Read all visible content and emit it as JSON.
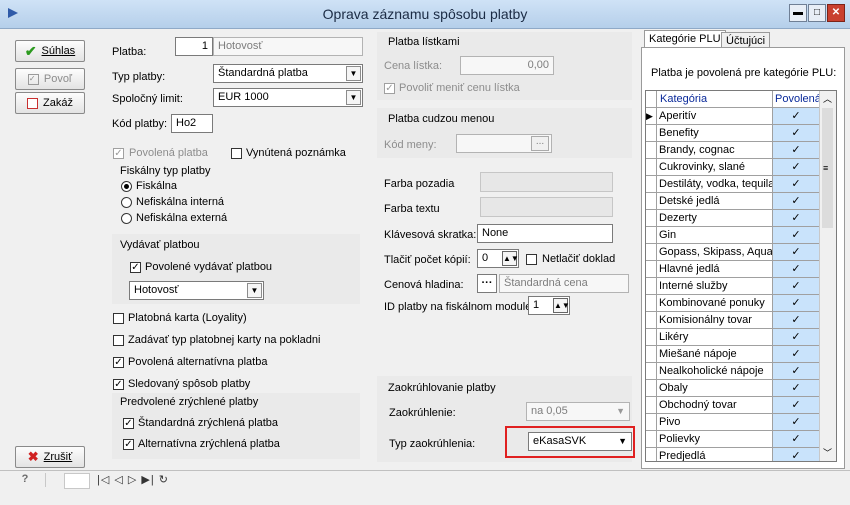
{
  "window": {
    "title": "Oprava záznamu spôsobu platby"
  },
  "buttons": {
    "ok": "Súhlas",
    "allow": "Povoľ",
    "forbid": "Zakáž",
    "cancel": "Zrušiť"
  },
  "form": {
    "platba_label": "Platba:",
    "platba_num": "1",
    "platba_name": "Hotovosť",
    "typ_label": "Typ platby:",
    "typ_value": "Štandardná platba",
    "limit_label": "Spoločný limit:",
    "limit_value": "EUR 1000",
    "kod_label": "Kód platby:",
    "kod_value": "Ho2",
    "povolena_label": "Povolená platba",
    "vynutena_label": "Vynútená poznámka",
    "fiscal_group": "Fiskálny typ platby",
    "fiscal_options": [
      "Fiskálna",
      "Nefiskálna interná",
      "Nefiskálna externá"
    ],
    "vydavat_group": "Vydávať platbou",
    "vydavat_check": "Povolené vydávať platbou",
    "vydavat_value": "Hotovosť",
    "check_loyalty": "Platobná karta (Loyality)",
    "check_zadavat": "Zadávať typ platobnej karty na pokladni",
    "check_alternativna": "Povolená alternatívna platba",
    "check_sledovany": "Sledovaný spôsob platby",
    "quick_group": "Predvolené zrýchlené platby",
    "quick_std": "Štandardná zrýchlená platba",
    "quick_alt": "Alternatívna zrýchlená platba"
  },
  "ticket": {
    "group": "Platba lístkami",
    "cena_label": "Cena lístka:",
    "cena_value": "0,00",
    "povolit": "Povoliť meniť cenu lístka"
  },
  "foreign": {
    "group": "Platba cudzou menou",
    "kod_label": "Kód meny:",
    "dots": "..."
  },
  "misc": {
    "farba_pozadia": "Farba pozadia",
    "farba_textu": "Farba textu",
    "klavesova_label": "Klávesová skratka:",
    "klavesova_value": "None",
    "tlac_label": "Tlačiť počet kópií:",
    "tlac_value": "0",
    "netlacit": "Netlačiť doklad",
    "cenova_label": "Cenová hladina:",
    "cenova_value": "Štandardná cena",
    "id_label": "ID platby na fiskálnom module",
    "id_value": "1"
  },
  "rounding": {
    "group": "Zaokrúhlovanie platby",
    "zaok_label": "Zaokrúhlenie:",
    "zaok_value": "na 0,05",
    "typ_label": "Typ zaokrúhlenia:",
    "typ_value": "eKasaSVK",
    "highlight_color": "#e02020"
  },
  "tabs": [
    "Kategórie PLU",
    "Účtujúci"
  ],
  "plu": {
    "info": "Platba je povolená pre kategórie PLU:",
    "headers": [
      "Kategória",
      "Povolená"
    ],
    "rows": [
      "Aperitív",
      "Benefity",
      "Brandy, cognac",
      "Cukrovinky, slané",
      "Destiláty, vodka, tequila",
      "Detské jedlá",
      "Dezerty",
      "Gin",
      "Gopass, Skipass, Aquapark",
      "Hlavné jedlá",
      "Interné služby",
      "Kombinované ponuky",
      "Komisionálny tovar",
      "Likéry",
      "Miešané nápoje",
      "Nealkoholické nápoje",
      "Obaly",
      "Obchodný tovar",
      "Pivo",
      "Polievky",
      "Predjedlá"
    ],
    "check_mark": "✓"
  },
  "statusbar": {
    "help": "?",
    "nav": "|◁  ◁  ▷  ▶|  ↻"
  }
}
